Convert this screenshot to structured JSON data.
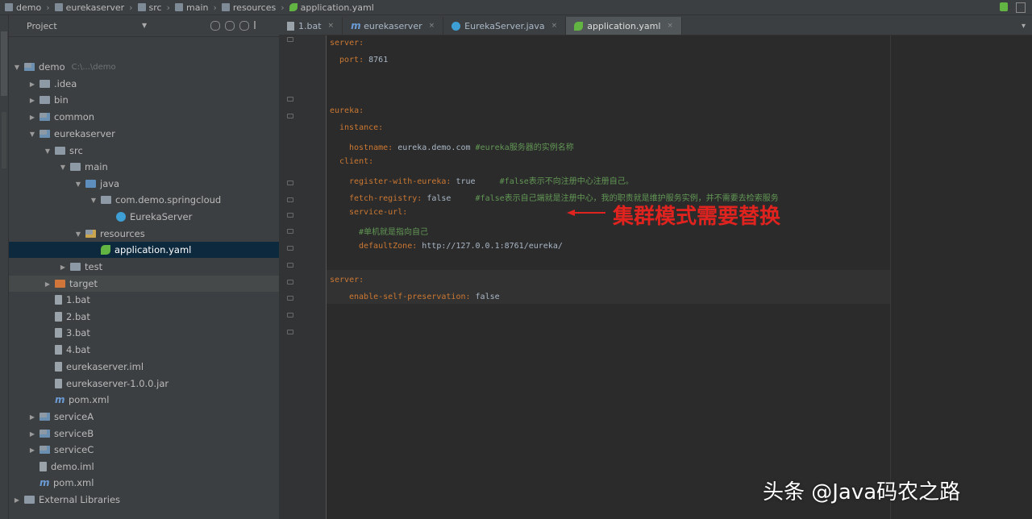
{
  "breadcrumbs": [
    "demo",
    "eurekaserver",
    "src",
    "main",
    "resources",
    "application.yaml"
  ],
  "project_panel": {
    "title": "Project"
  },
  "tree": [
    {
      "label": "demo",
      "path": "C:\\...\\demo",
      "level": 0,
      "arrow": "down",
      "icon": "mod"
    },
    {
      "label": ".idea",
      "level": 1,
      "arrow": "right",
      "icon": "folder"
    },
    {
      "label": "bin",
      "level": 1,
      "arrow": "right",
      "icon": "folder"
    },
    {
      "label": "common",
      "level": 1,
      "arrow": "right",
      "icon": "mod"
    },
    {
      "label": "eurekaserver",
      "level": 1,
      "arrow": "down",
      "icon": "mod"
    },
    {
      "label": "src",
      "level": 2,
      "arrow": "down",
      "icon": "folder"
    },
    {
      "label": "main",
      "level": 3,
      "arrow": "down",
      "icon": "folder"
    },
    {
      "label": "java",
      "level": 4,
      "arrow": "down",
      "icon": "blue"
    },
    {
      "label": "com.demo.springcloud",
      "level": 5,
      "arrow": "down",
      "icon": "folder"
    },
    {
      "label": "EurekaServer",
      "level": 6,
      "arrow": "",
      "icon": "java"
    },
    {
      "label": "resources",
      "level": 4,
      "arrow": "down",
      "icon": "res"
    },
    {
      "label": "application.yaml",
      "level": 5,
      "arrow": "",
      "icon": "yaml",
      "selected": true
    },
    {
      "label": "test",
      "level": 3,
      "arrow": "right",
      "icon": "folder"
    },
    {
      "label": "target",
      "level": 2,
      "arrow": "right",
      "icon": "orange",
      "highlight": true
    },
    {
      "label": "1.bat",
      "level": 2,
      "arrow": "",
      "icon": "file"
    },
    {
      "label": "2.bat",
      "level": 2,
      "arrow": "",
      "icon": "file"
    },
    {
      "label": "3.bat",
      "level": 2,
      "arrow": "",
      "icon": "file"
    },
    {
      "label": "4.bat",
      "level": 2,
      "arrow": "",
      "icon": "file"
    },
    {
      "label": "eurekaserver.iml",
      "level": 2,
      "arrow": "",
      "icon": "file"
    },
    {
      "label": "eurekaserver-1.0.0.jar",
      "level": 2,
      "arrow": "",
      "icon": "file"
    },
    {
      "label": "pom.xml",
      "level": 2,
      "arrow": "",
      "icon": "mvn"
    },
    {
      "label": "serviceA",
      "level": 1,
      "arrow": "right",
      "icon": "mod"
    },
    {
      "label": "serviceB",
      "level": 1,
      "arrow": "right",
      "icon": "mod"
    },
    {
      "label": "serviceC",
      "level": 1,
      "arrow": "right",
      "icon": "mod"
    },
    {
      "label": "demo.iml",
      "level": 1,
      "arrow": "",
      "icon": "file"
    },
    {
      "label": "pom.xml",
      "level": 1,
      "arrow": "",
      "icon": "mvn"
    },
    {
      "label": "External Libraries",
      "level": 0,
      "arrow": "right",
      "icon": "folder"
    }
  ],
  "tabs": [
    {
      "label": "1.bat",
      "icon": "file",
      "active": false
    },
    {
      "label": "eurekaserver",
      "icon": "mvn",
      "active": false
    },
    {
      "label": "EurekaServer.java",
      "icon": "java",
      "active": false
    },
    {
      "label": "application.yaml",
      "icon": "yaml",
      "active": true
    }
  ],
  "code_lines": [
    {
      "indent": 0,
      "key": "server:",
      "value": "",
      "comment": ""
    },
    {
      "indent": 1,
      "key": "port:",
      "value": " 8761",
      "comment": ""
    },
    {
      "indent": 0,
      "key": "",
      "value": "",
      "comment": ""
    },
    {
      "indent": 0,
      "key": "",
      "value": "",
      "comment": ""
    },
    {
      "indent": 0,
      "key": "eureka:",
      "value": "",
      "comment": ""
    },
    {
      "indent": 1,
      "key": "instance:",
      "value": "",
      "comment": ""
    },
    {
      "indent": 2,
      "key": "hostname:",
      "value": " eureka.demo.com ",
      "comment": "#eureka服务器的实例名称"
    },
    {
      "indent": 1,
      "key": "client:",
      "value": "",
      "comment": ""
    },
    {
      "indent": 2,
      "key": "register-with-eureka:",
      "value": " true     ",
      "comment": "#false表示不向注册中心注册自己。"
    },
    {
      "indent": 2,
      "key": "fetch-registry:",
      "value": " false     ",
      "comment": "#false表示自己端就是注册中心，我的职责就是维护服务实例，并不需要去检索服务"
    },
    {
      "indent": 2,
      "key": "service-url:",
      "value": "",
      "comment": ""
    },
    {
      "indent": 3,
      "key": "",
      "value": "",
      "comment": "#单机就是指向自己"
    },
    {
      "indent": 3,
      "key": "defaultZone:",
      "value": " http://127.0.0.1:8761/eureka/",
      "comment": ""
    },
    {
      "indent": 0,
      "key": "",
      "value": "",
      "comment": ""
    },
    {
      "indent": 0,
      "key": "server:",
      "value": "",
      "comment": ""
    },
    {
      "indent": 2,
      "key": "enable-self-preservation:",
      "value": " false",
      "comment": ""
    }
  ],
  "annotation": "集群模式需要替换",
  "watermark": "头条 @Java码农之路",
  "colors": {
    "keyword": "#cc7832",
    "value": "#a9b7c6",
    "comment": "#629755",
    "annotation": "#e0231f",
    "selection": "#0d293e"
  }
}
